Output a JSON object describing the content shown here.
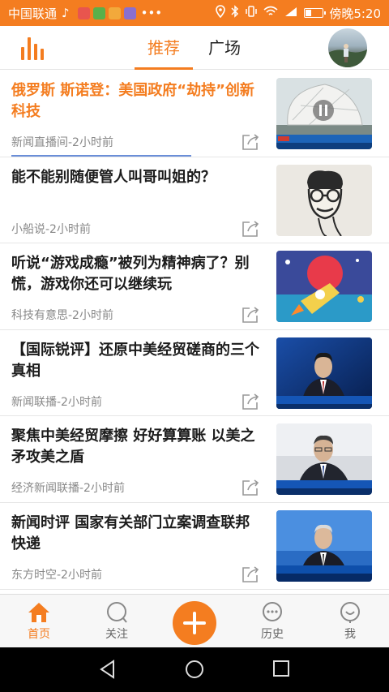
{
  "status_bar": {
    "carrier": "中国联通",
    "time": "傍晚5:20",
    "app_icon_colors": [
      "#e8554e",
      "#59b04a",
      "#f2a93b",
      "#8a6fd0"
    ],
    "battery_level": 0.3
  },
  "header": {
    "tabs": [
      {
        "label": "推荐",
        "active": true
      },
      {
        "label": "广场",
        "active": false
      }
    ],
    "accent_color": "#f47d20"
  },
  "feed": [
    {
      "title": "俄罗斯 斯诺登：美国政府“劫持”创新科技",
      "meta": "新闻直播间-2小时前",
      "thumb": "satellite-dish-video"
    },
    {
      "title": "能不能别随便管人叫哥叫姐的？",
      "meta": "小船说-2小时前",
      "thumb": "cartoon-face"
    },
    {
      "title": "听说“游戏成瘾”被列为精神病了？别慌，游戏你还可以继续玩",
      "meta": "科技有意思-2小时前",
      "thumb": "rocket-poster"
    },
    {
      "title": "【国际锐评】还原中美经贸磋商的三个真相",
      "meta": "新闻联播-2小时前",
      "thumb": "news-anchor"
    },
    {
      "title": "聚焦中美经贸摩擦 好好算算账 以美之矛攻美之盾",
      "meta": "经济新闻联播-2小时前",
      "thumb": "press-conference"
    },
    {
      "title": "新闻时评 国家有关部门立案调查联邦快递",
      "meta": "东方时空-2小时前",
      "thumb": "news-anchor-2"
    }
  ],
  "bottom_nav": [
    {
      "label": "首页",
      "icon": "home-icon",
      "active": true
    },
    {
      "label": "关注",
      "icon": "follow-icon",
      "active": false
    },
    {
      "label": "历史",
      "icon": "history-icon",
      "active": false
    },
    {
      "label": "我",
      "icon": "profile-icon",
      "active": false
    }
  ]
}
